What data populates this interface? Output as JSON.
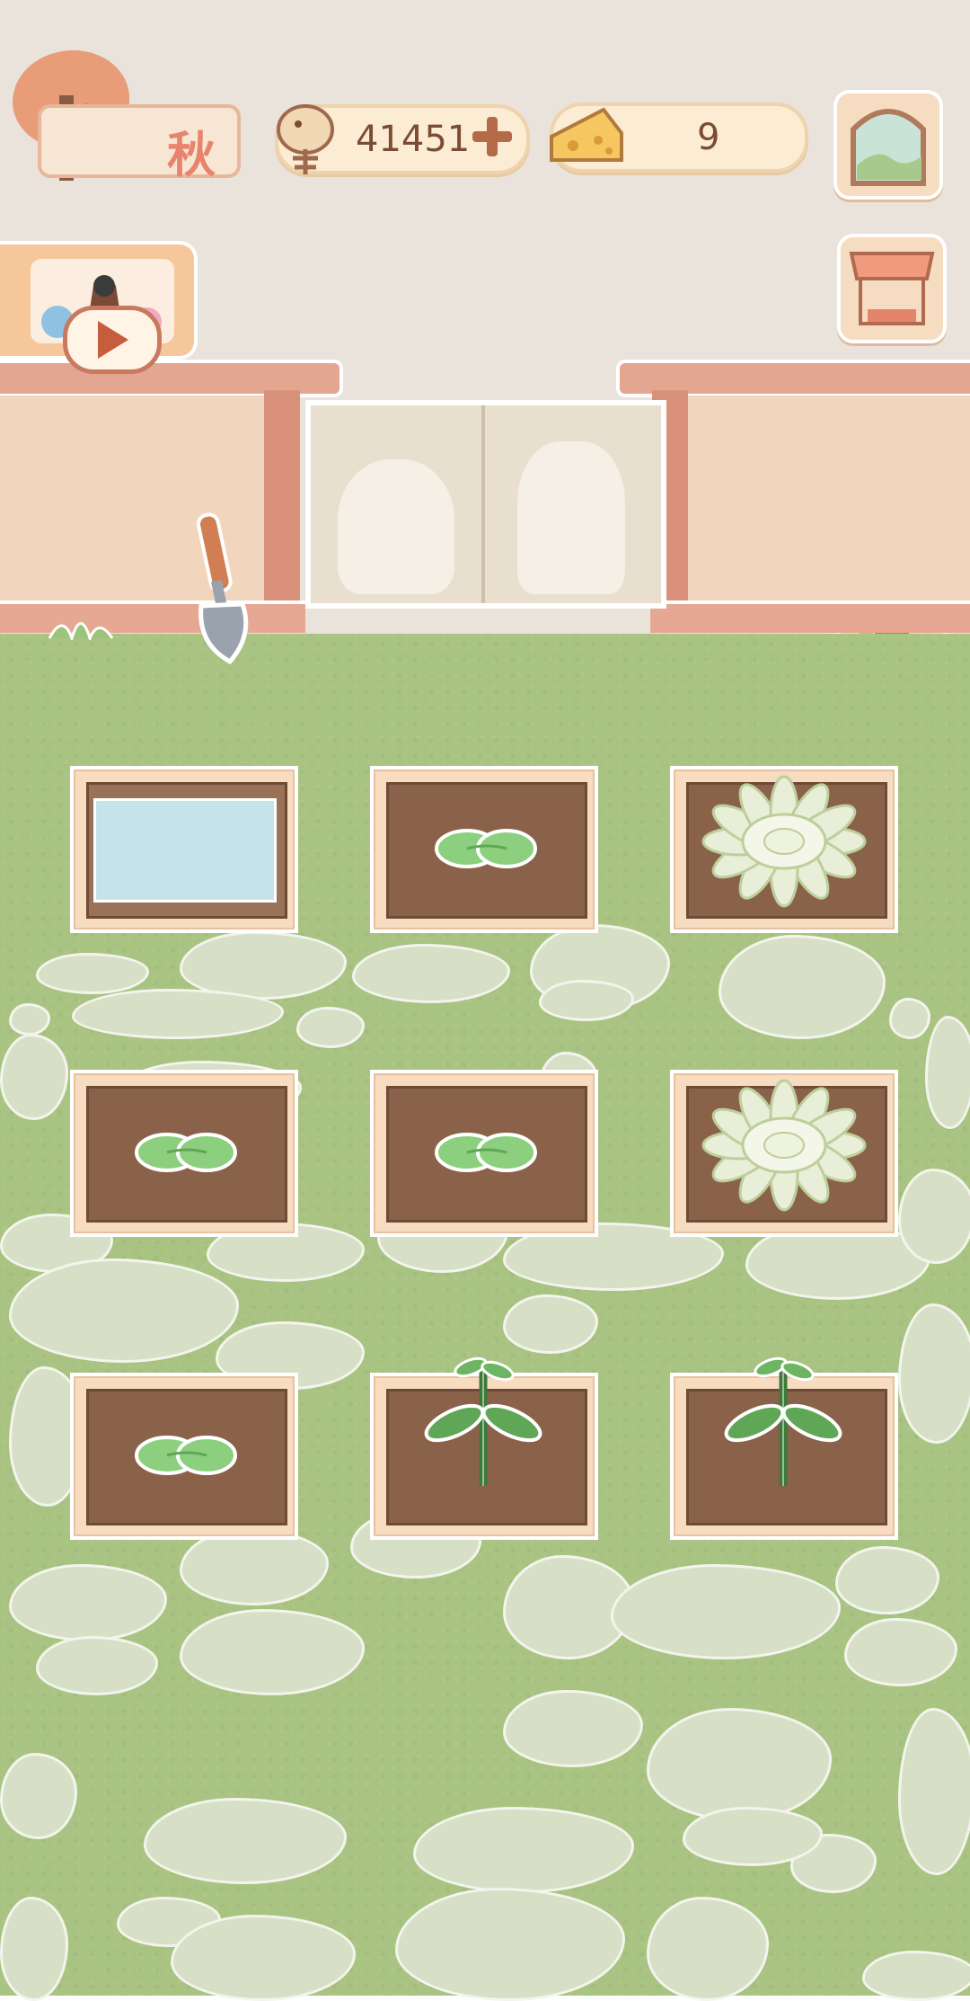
{
  "season": {
    "label": "秋"
  },
  "currency": {
    "fish_icon": "fishbone-icon",
    "fish_value": "41451",
    "add_icon": "plus-icon",
    "cheese_icon": "cheese-icon",
    "cheese_value": "9"
  },
  "side_menu": [
    {
      "name": "window-view-button",
      "icon": "window-icon"
    },
    {
      "name": "shop-stall-button",
      "icon": "market-stall-icon"
    },
    {
      "name": "basket-button",
      "icon": "basket-icon"
    },
    {
      "name": "trophy-button",
      "icon": "trophy-icon"
    }
  ],
  "video_ad": {
    "icon": "play-icon"
  },
  "garden": {
    "plots": [
      {
        "state": "water"
      },
      {
        "state": "seedling"
      },
      {
        "state": "lotus"
      },
      {
        "state": "seedling"
      },
      {
        "state": "seedling"
      },
      {
        "state": "lotus"
      },
      {
        "state": "seedling"
      },
      {
        "state": "sprout"
      },
      {
        "state": "sprout"
      }
    ]
  },
  "colors": {
    "accent": "#e8846e",
    "grass": "#a9c382",
    "soil": "#8a6249"
  }
}
